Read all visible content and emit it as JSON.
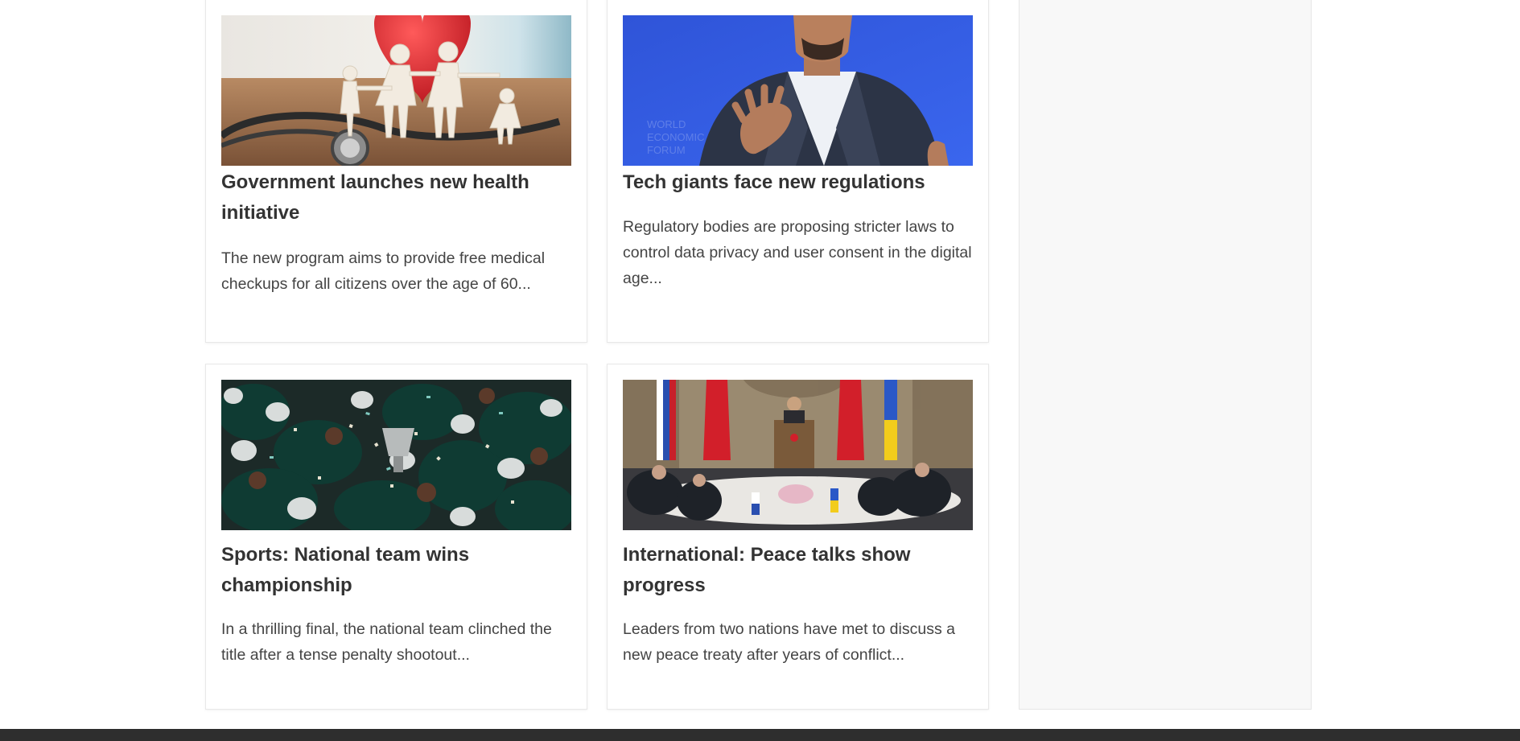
{
  "articles": [
    {
      "image": "family-paper-cutout-heart-stethoscope",
      "title": "Government launches new health initiative",
      "excerpt": "The new program aims to provide free medical checkups for all citizens over the age of 60..."
    },
    {
      "image": "speaker-in-suit-blue-backdrop",
      "title": "Tech giants face new regulations",
      "excerpt": "Regulatory bodies are proposing stricter laws to control data privacy and user consent in the digital age..."
    },
    {
      "image": "team-celebrating-with-trophy-confetti",
      "title": "Sports: National team wins championship",
      "excerpt": "In a thrilling final, the national team clinched the title after a tense penalty shootout..."
    },
    {
      "image": "delegations-at-table-with-flags",
      "title": "International: Peace talks show progress",
      "excerpt": "Leaders from two nations have met to discuss a new peace treaty after years of conflict..."
    }
  ],
  "colors": {
    "text": "#333333",
    "card_border": "#e8e8e8",
    "sidebar_bg": "#f8f8f8",
    "footer_bg": "#2e2e2e"
  }
}
